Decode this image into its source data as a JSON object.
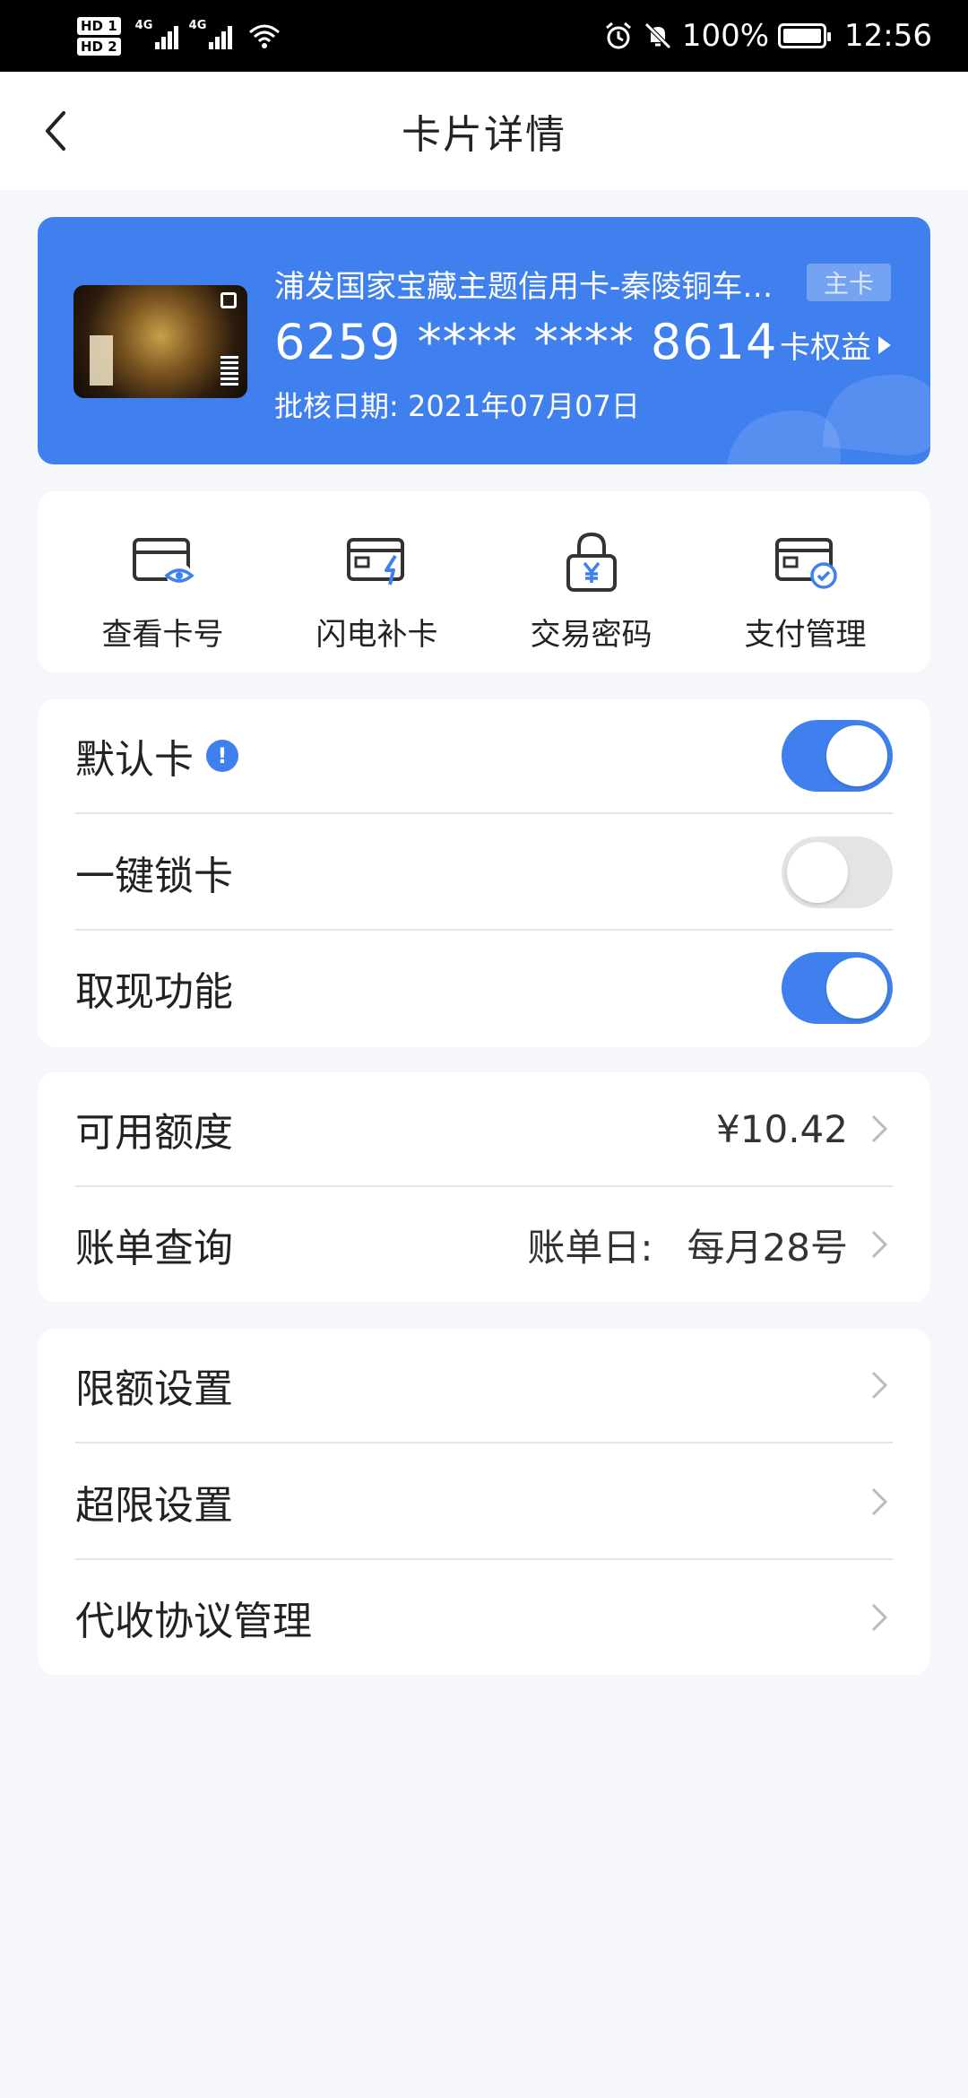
{
  "status_bar": {
    "sim1": "HD 1",
    "sim2": "HD 2",
    "net1": "4G",
    "net2": "4G",
    "battery": "100%",
    "time": "12:56",
    "icons": [
      "alarm-icon",
      "mute-icon",
      "battery-icon",
      "wifi-icon"
    ]
  },
  "nav": {
    "title": "卡片详情"
  },
  "card": {
    "name": "浦发国家宝藏主题信用卡-秦陵铜车马主题卡",
    "number": "6259 **** **** 8614",
    "approval_date": "批核日期: 2021年07月07日",
    "badge": "主卡",
    "benefits": "卡权益"
  },
  "quick_actions": [
    {
      "label": "查看卡号",
      "icon": "card-eye-icon"
    },
    {
      "label": "闪电补卡",
      "icon": "card-lightning-icon"
    },
    {
      "label": "交易密码",
      "icon": "lock-yen-icon"
    },
    {
      "label": "支付管理",
      "icon": "card-check-icon"
    }
  ],
  "settings": {
    "default_card": {
      "label": "默认卡",
      "on": true
    },
    "lock_card": {
      "label": "一键锁卡",
      "on": false
    },
    "cash_withdrawal": {
      "label": "取现功能",
      "on": true
    }
  },
  "account": {
    "available_limit": {
      "label": "可用额度",
      "value": "¥10.42"
    },
    "bill_query": {
      "label": "账单查询",
      "prefix": "账单日:",
      "value": "每月28号"
    }
  },
  "limits": [
    {
      "label": "限额设置"
    },
    {
      "label": "超限设置"
    },
    {
      "label": "代收协议管理"
    }
  ],
  "colors": {
    "accent": "#3f80ee",
    "background": "#f6f7fb"
  }
}
